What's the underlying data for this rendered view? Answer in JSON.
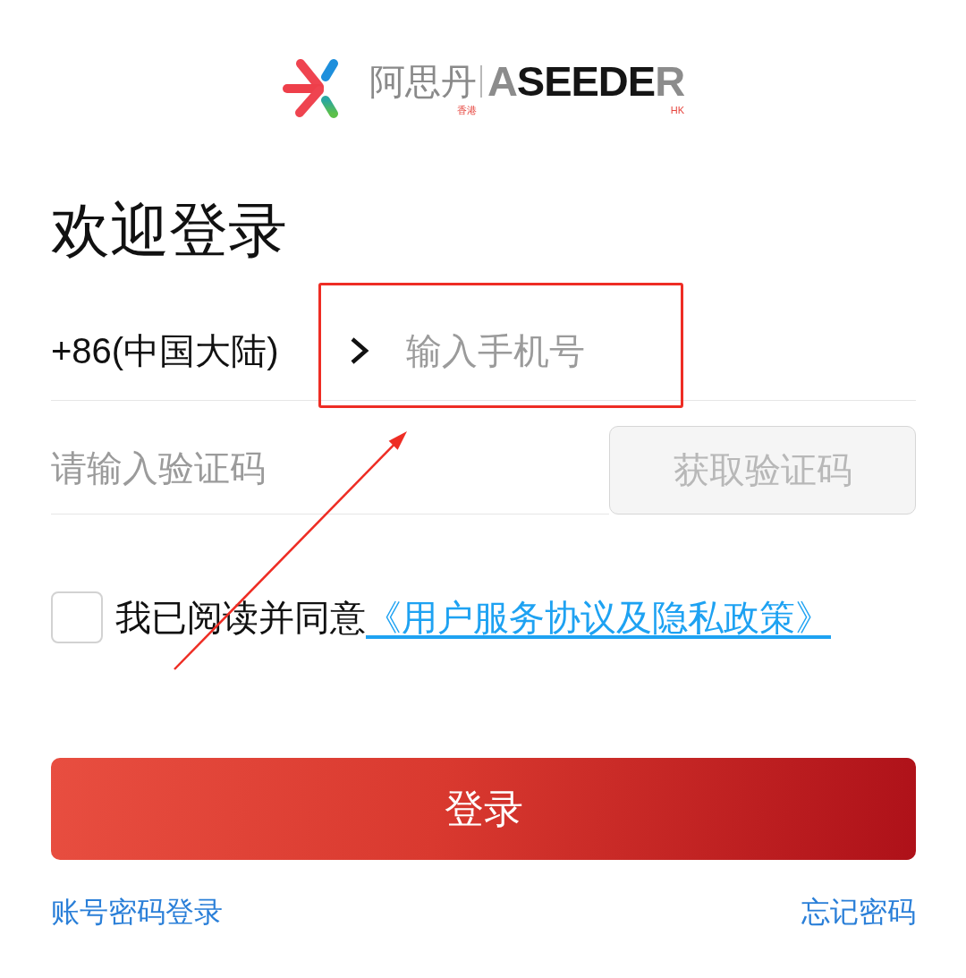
{
  "logo": {
    "name_cn": "阿思丹",
    "region_cn": "香港",
    "name_en": "A**SEEDE**R",
    "region_en": "HK"
  },
  "title": "欢迎登录",
  "phone": {
    "country": "+86(中国大陆)",
    "placeholder": "输入手机号"
  },
  "code": {
    "placeholder": "请输入验证码",
    "button": {
      "label": "获取验证码",
      "disabled": true
    }
  },
  "agreement": {
    "checked": false,
    "text": "我已阅读并同意",
    "link": "《用户服务协议及隐私政策》"
  },
  "login_button": {
    "label": "登录"
  },
  "footer_links": [
    {
      "label": "账号密码登录"
    },
    {
      "label": "忘记密码"
    }
  ],
  "annotations": [
    {
      "kind": "box"
    },
    {
      "kind": "arrow"
    }
  ]
}
